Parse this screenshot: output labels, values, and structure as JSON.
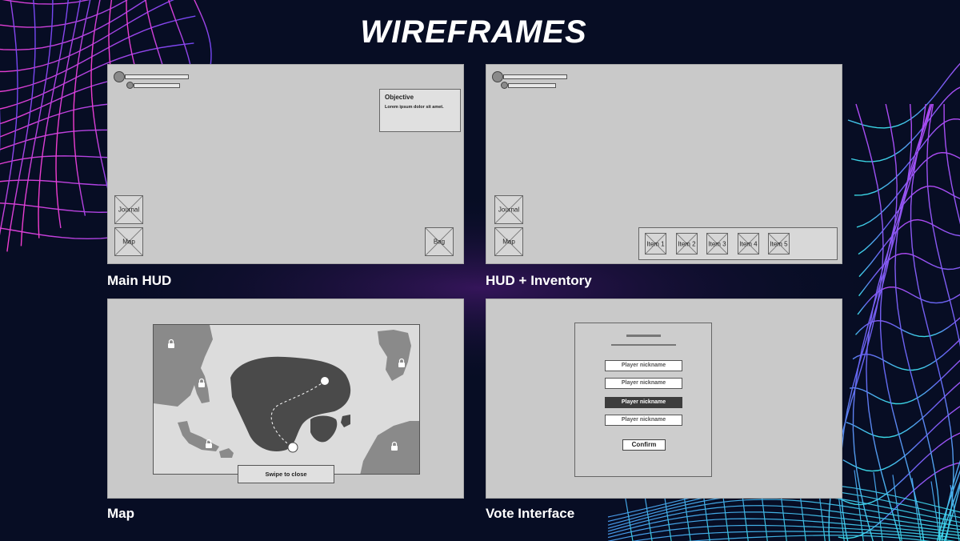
{
  "page": {
    "title": "WIREFRAMES"
  },
  "panels": {
    "main_hud": {
      "label": "Main HUD",
      "objective_title": "Objective",
      "objective_text": "Lorem ipsum dolor sit amet.",
      "journal": "Journal",
      "map": "Map",
      "bag": "Bag"
    },
    "hud_inventory": {
      "label": "HUD + Inventory",
      "journal": "Journal",
      "map": "Map",
      "items": [
        "Item 1",
        "Item 2",
        "Item 3",
        "Item 4",
        "Item 5"
      ]
    },
    "map": {
      "label": "Map",
      "swipe": "Swipe to close"
    },
    "vote": {
      "label": "Vote Interface",
      "nicknames": [
        "Player nickname",
        "Player nickname",
        "Player nickname",
        "Player nickname"
      ],
      "selected_index": 2,
      "confirm": "Confirm"
    }
  },
  "colors": {
    "background": "#070d24",
    "panel": "#c9c9c9",
    "accent_pink": "#d63cff",
    "accent_blue": "#5a6bff",
    "accent_cyan": "#3cd6e6"
  }
}
